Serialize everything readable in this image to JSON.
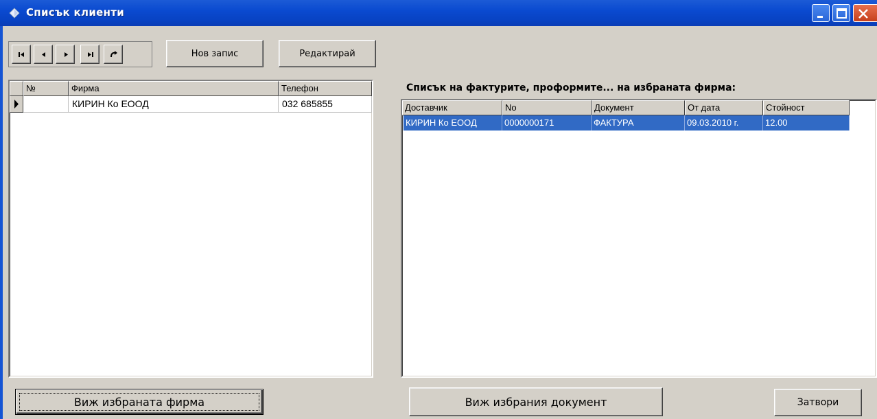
{
  "window": {
    "title": "Списък клиенти"
  },
  "toolbar": {
    "nav": [
      "first-icon",
      "prev-icon",
      "next-icon",
      "last-icon",
      "refresh-icon"
    ],
    "new_label": "Нов запис",
    "edit_label": "Редактирай"
  },
  "clients": {
    "columns": [
      "№",
      "Фирма",
      "Телефон"
    ],
    "rows": [
      {
        "no": "",
        "firm": "КИРИН Ко ЕООД",
        "phone": "032 685855"
      }
    ]
  },
  "documents": {
    "caption": "Списък на фактурите, проформите... на избраната фирма:",
    "columns": [
      "Доставчик",
      "No",
      "Документ",
      "От дата",
      "Стойност"
    ],
    "rows": [
      {
        "supplier": "КИРИН Ко ЕООД",
        "no": "0000000171",
        "doc": "ФАКТУРА",
        "date": "09.03.2010 г.",
        "value": "12.00"
      }
    ]
  },
  "footer": {
    "view_firm_label": "Виж избраната фирма",
    "view_doc_label": "Виж избрания документ",
    "close_label": "Затвори"
  },
  "colors": {
    "titlebar": "#0a4ad0",
    "selection": "#316ac5",
    "face": "#d4d0c8"
  }
}
